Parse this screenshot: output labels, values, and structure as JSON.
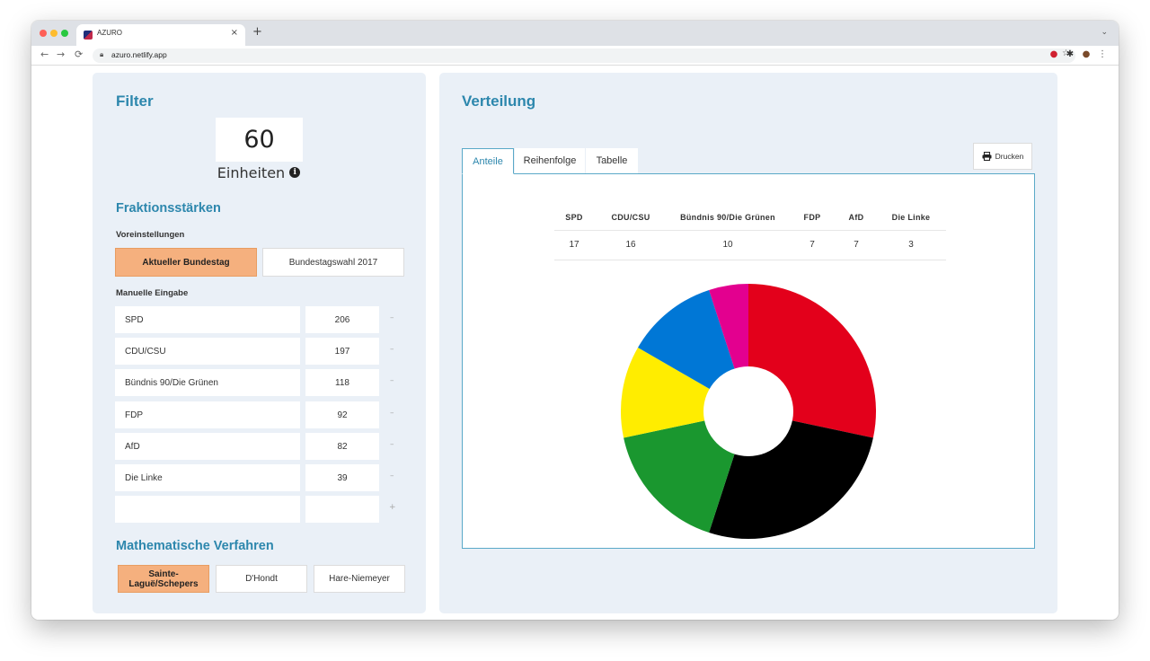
{
  "browser": {
    "tab_title": "AZURO",
    "tab_close": "×",
    "new_tab": "+",
    "url": "azuro.netlify.app",
    "traffic_lights": [
      "#fe5f57",
      "#febc2e",
      "#28c840"
    ]
  },
  "filter": {
    "title": "Filter",
    "units_value": "60",
    "units_label": "Einheiten",
    "info_icon": "info-icon",
    "fraktion_title": "Fraktionsstärken",
    "presets_label": "Voreinstellungen",
    "presets": [
      "Aktueller Bundestag",
      "Bundestagswahl 2017"
    ],
    "manual_label": "Manuelle Eingabe",
    "rows": [
      {
        "name": "SPD",
        "seats": "206"
      },
      {
        "name": "CDU/CSU",
        "seats": "197"
      },
      {
        "name": "Bündnis 90/Die Grünen",
        "seats": "118"
      },
      {
        "name": "FDP",
        "seats": "92"
      },
      {
        "name": "AfD",
        "seats": "82"
      },
      {
        "name": "Die Linke",
        "seats": "39"
      }
    ],
    "minus_label": "–",
    "plus_label": "+",
    "methods_title": "Mathematische Verfahren",
    "methods": [
      "Sainte-Laguë/Schepers",
      "D'Hondt",
      "Hare-Niemeyer"
    ]
  },
  "distribution": {
    "title": "Verteilung",
    "tabs": [
      "Anteile",
      "Reihenfolge",
      "Tabelle"
    ],
    "print_label": "Drucken",
    "table_headers": [
      "SPD",
      "CDU/CSU",
      "Bündnis 90/Die Grünen",
      "FDP",
      "AfD",
      "Die Linke"
    ],
    "table_values": [
      "17",
      "16",
      "10",
      "7",
      "7",
      "3"
    ]
  },
  "chart_data": {
    "type": "pie",
    "categories": [
      "SPD",
      "CDU/CSU",
      "Bündnis 90/Die Grünen",
      "FDP",
      "AfD",
      "Die Linke"
    ],
    "values": [
      17,
      16,
      10,
      7,
      7,
      3
    ],
    "colors": [
      "#e3001b",
      "#000000",
      "#1a972f",
      "#ffed00",
      "#0077d6",
      "#e3008f"
    ],
    "donut": true
  }
}
